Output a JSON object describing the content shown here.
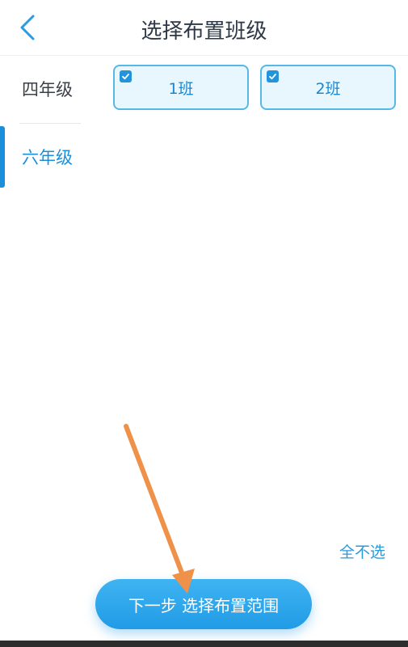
{
  "header": {
    "title": "选择布置班级",
    "back_icon": "chevron-left-icon"
  },
  "sidebar": {
    "items": [
      {
        "label": "四年级",
        "selected": false
      },
      {
        "label": "六年级",
        "selected": true
      }
    ],
    "active_color": "#1b8fd9"
  },
  "classes": [
    {
      "label": "1班",
      "checked": true
    },
    {
      "label": "2班",
      "checked": true
    }
  ],
  "actions": {
    "deselect_all": "全不选",
    "next_button": "下一步 选择布置范围"
  },
  "annotation": {
    "type": "arrow",
    "color": "#f0914a",
    "points_to": "next-step-button"
  },
  "colors": {
    "accent": "#219be6",
    "card_background": "#e8f6fd",
    "card_border": "#57b8e7"
  }
}
